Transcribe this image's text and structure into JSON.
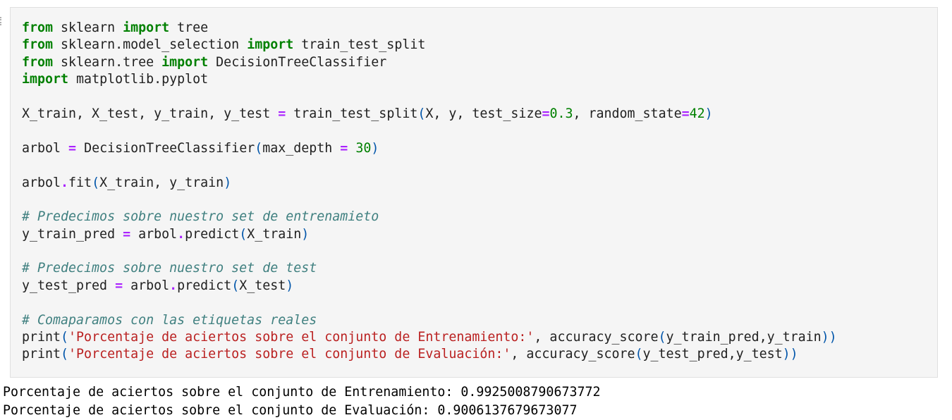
{
  "cell": {
    "lines": [
      [
        [
          "kw",
          "from"
        ],
        [
          "t",
          " sklearn "
        ],
        [
          "kw",
          "import"
        ],
        [
          "t",
          " tree"
        ]
      ],
      [
        [
          "kw",
          "from"
        ],
        [
          "t",
          " sklearn.model_selection "
        ],
        [
          "kw",
          "import"
        ],
        [
          "t",
          " train_test_split"
        ]
      ],
      [
        [
          "kw",
          "from"
        ],
        [
          "t",
          " sklearn.tree "
        ],
        [
          "kw",
          "import"
        ],
        [
          "t",
          " DecisionTreeClassifier"
        ]
      ],
      [
        [
          "kw",
          "import"
        ],
        [
          "t",
          " matplotlib.pyplot"
        ]
      ],
      [],
      [
        [
          "t",
          "X_train, X_test, y_train, y_test "
        ],
        [
          "op",
          "="
        ],
        [
          "t",
          " train_test_split"
        ],
        [
          "par",
          "("
        ],
        [
          "t",
          "X, y, test_size"
        ],
        [
          "op",
          "="
        ],
        [
          "num",
          "0.3"
        ],
        [
          "t",
          ", random_state"
        ],
        [
          "op",
          "="
        ],
        [
          "num",
          "42"
        ],
        [
          "par",
          ")"
        ]
      ],
      [],
      [
        [
          "t",
          "arbol "
        ],
        [
          "op",
          "="
        ],
        [
          "t",
          " DecisionTreeClassifier"
        ],
        [
          "par",
          "("
        ],
        [
          "t",
          "max_depth "
        ],
        [
          "op",
          "="
        ],
        [
          "t",
          " "
        ],
        [
          "num",
          "30"
        ],
        [
          "par",
          ")"
        ]
      ],
      [],
      [
        [
          "t",
          "arbol"
        ],
        [
          "op",
          "."
        ],
        [
          "t",
          "fit"
        ],
        [
          "par",
          "("
        ],
        [
          "t",
          "X_train, y_train"
        ],
        [
          "par",
          ")"
        ]
      ],
      [],
      [
        [
          "com",
          "# Predecimos sobre nuestro set de entrenamieto"
        ]
      ],
      [
        [
          "t",
          "y_train_pred "
        ],
        [
          "op",
          "="
        ],
        [
          "t",
          " arbol"
        ],
        [
          "op",
          "."
        ],
        [
          "t",
          "predict"
        ],
        [
          "par",
          "("
        ],
        [
          "t",
          "X_train"
        ],
        [
          "par",
          ")"
        ]
      ],
      [],
      [
        [
          "com",
          "# Predecimos sobre nuestro set de test"
        ]
      ],
      [
        [
          "t",
          "y_test_pred "
        ],
        [
          "op",
          "="
        ],
        [
          "t",
          " arbol"
        ],
        [
          "op",
          "."
        ],
        [
          "t",
          "predict"
        ],
        [
          "par",
          "("
        ],
        [
          "t",
          "X_test"
        ],
        [
          "par",
          ")"
        ]
      ],
      [],
      [
        [
          "com",
          "# Comaparamos con las etiquetas reales"
        ]
      ],
      [
        [
          "t",
          "print"
        ],
        [
          "par",
          "("
        ],
        [
          "str",
          "'Porcentaje de aciertos sobre el conjunto de Entrenamiento:'"
        ],
        [
          "t",
          ", accuracy_score"
        ],
        [
          "par",
          "("
        ],
        [
          "t",
          "y_train_pred,y_train"
        ],
        [
          "par",
          "))"
        ]
      ],
      [
        [
          "t",
          "print"
        ],
        [
          "par",
          "("
        ],
        [
          "str",
          "'Porcentaje de aciertos sobre el conjunto de Evaluación:'"
        ],
        [
          "t",
          ", accuracy_score"
        ],
        [
          "par",
          "("
        ],
        [
          "t",
          "y_test_pred,y_test"
        ],
        [
          "par",
          "))"
        ]
      ]
    ]
  },
  "output": {
    "lines": [
      "Porcentaje de aciertos sobre el conjunto de Entrenamiento: 0.9925008790673772",
      "Porcentaje de aciertos sobre el conjunto de Evaluación: 0.9006137679673077"
    ]
  },
  "colors": {
    "keyword": "#008000",
    "operator": "#aa22ff",
    "number": "#008000",
    "string": "#ba2121",
    "comment": "#408080",
    "paren": "#0055aa",
    "cell_background": "#f5f5f5"
  }
}
